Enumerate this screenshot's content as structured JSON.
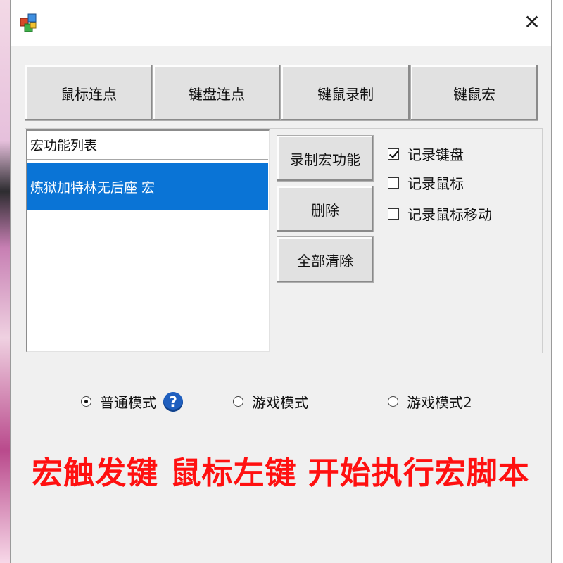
{
  "tabs": [
    {
      "label": "鼠标连点"
    },
    {
      "label": "键盘连点"
    },
    {
      "label": "键鼠录制"
    },
    {
      "label": "键鼠宏"
    }
  ],
  "macro_list": {
    "header": "宏功能列表",
    "items": [
      {
        "label": "炼狱加特林无后座 宏",
        "selected": true
      }
    ]
  },
  "actions": {
    "record_label": "录制宏功能",
    "delete_label": "删除",
    "clear_all_label": "全部清除"
  },
  "record_options": [
    {
      "label": "记录键盘",
      "checked": true
    },
    {
      "label": "记录鼠标",
      "checked": false
    },
    {
      "label": "记录鼠标移动",
      "checked": false
    }
  ],
  "modes": [
    {
      "label": "普通模式",
      "selected": true
    },
    {
      "label": "游戏模式",
      "selected": false
    },
    {
      "label": "游戏模式2",
      "selected": false
    }
  ],
  "trigger_text": "宏触发键  鼠标左键  开始执行宏脚本",
  "title_bar": {
    "close_symbol": "✕",
    "app_icon": "app-icon"
  },
  "help": {
    "symbol": "?"
  },
  "colors": {
    "selection": "#0a74d6",
    "trigger_text": "#ff1010",
    "help_icon": "#1f5fbf"
  }
}
